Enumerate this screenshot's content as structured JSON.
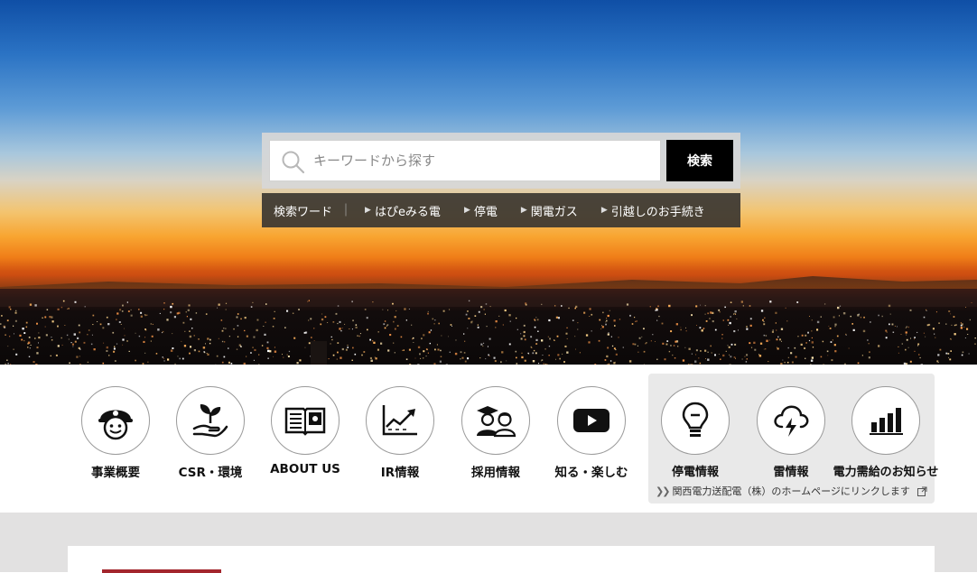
{
  "search": {
    "placeholder": "キーワードから探す",
    "button_label": "検索"
  },
  "keywords": {
    "label": "検索ワード",
    "separator": "｜",
    "items": [
      {
        "label": "はぴeみる電"
      },
      {
        "label": "停電"
      },
      {
        "label": "関電ガス"
      },
      {
        "label": "引越しのお手続き"
      }
    ]
  },
  "nav": {
    "items": [
      {
        "label": "事業概要",
        "icon": "worker-helmet-icon"
      },
      {
        "label": "CSR・環境",
        "icon": "plant-hand-icon"
      },
      {
        "label": "ABOUT US",
        "icon": "open-book-icon"
      },
      {
        "label": "IR情報",
        "icon": "line-chart-icon"
      },
      {
        "label": "採用情報",
        "icon": "graduates-icon"
      },
      {
        "label": "知る・楽しむ",
        "icon": "play-button-icon"
      }
    ],
    "power_panel": {
      "items": [
        {
          "label": "停電情報",
          "icon": "light-bulb-icon"
        },
        {
          "label": "雷情報",
          "icon": "thunder-cloud-icon"
        },
        {
          "label": "電力需給のお知らせ",
          "icon": "bar-chart-icon"
        }
      ],
      "note": "関西電力送配電（株）のホームページにリンクします"
    }
  },
  "colors": {
    "search_button": "#000000",
    "keyword_bar": "#3c3832",
    "power_panel": "#e9e9e9",
    "lower_bg": "#e2e1e1",
    "accent": "#a3262d"
  }
}
